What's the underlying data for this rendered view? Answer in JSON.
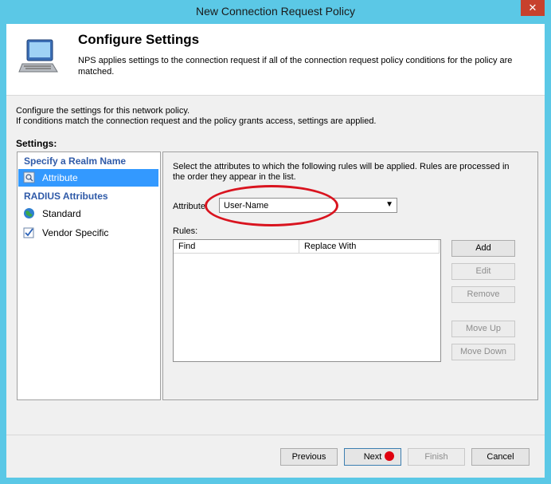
{
  "window": {
    "title": "New Connection Request Policy",
    "close_glyph": "✕"
  },
  "header": {
    "title": "Configure Settings",
    "description": "NPS applies settings to the connection request if all of the connection request policy conditions  for the policy are matched."
  },
  "intro": {
    "line1": "Configure the settings for this network policy.",
    "line2": "If conditions match the connection request and the policy grants access, settings are applied."
  },
  "settings_label": "Settings:",
  "nav": {
    "group1": "Specify a Realm Name",
    "attribute": "Attribute",
    "group2": "RADIUS Attributes",
    "standard": "Standard",
    "vendor_specific": "Vendor Specific"
  },
  "panel": {
    "instructions": "Select the attributes to which the following rules will be applied. Rules are processed in the order they appear in the list.",
    "attribute_label": "Attribute:",
    "attribute_value": "User-Name",
    "rules_label": "Rules:",
    "columns": [
      "Find",
      "Replace With"
    ],
    "buttons": {
      "add": "Add",
      "edit": "Edit",
      "remove": "Remove",
      "move_up": "Move Up",
      "move_down": "Move Down"
    }
  },
  "footer": {
    "previous": "Previous",
    "next": "Next",
    "finish": "Finish",
    "cancel": "Cancel"
  },
  "colors": {
    "title_bar": "#5bc8e6",
    "selection": "#3399ff",
    "group_heading": "#2f5aa8",
    "annotation": "#d9141f"
  }
}
